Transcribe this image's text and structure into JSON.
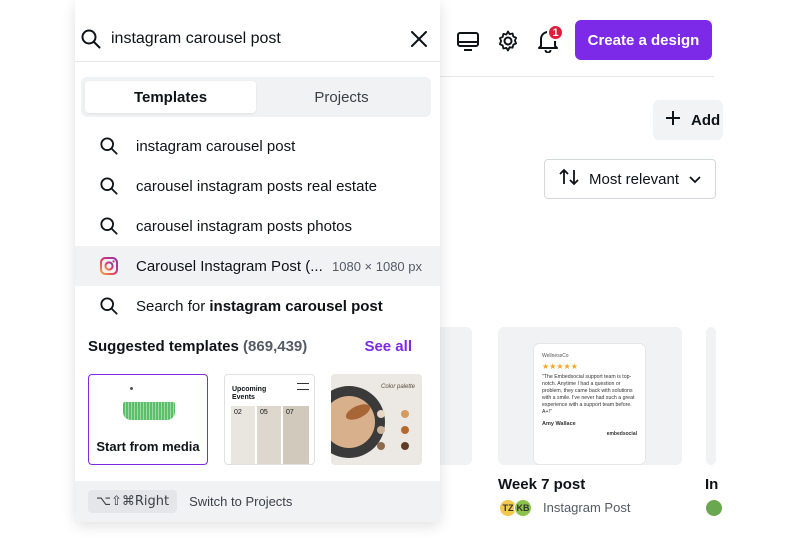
{
  "search": {
    "value": "instagram carousel post"
  },
  "tabs": [
    {
      "label": "Templates",
      "active": true
    },
    {
      "label": "Projects",
      "active": false
    }
  ],
  "suggestions": [
    {
      "text": "instagram carousel post",
      "icon": "search-icon"
    },
    {
      "text": "carousel instagram posts real estate",
      "icon": "search-icon"
    },
    {
      "text": "carousel instagram posts photos",
      "icon": "search-icon"
    }
  ],
  "highlighted_result": {
    "text": "Carousel Instagram Post (...",
    "dims": "1080 × 1080 px",
    "icon": "instagram-icon"
  },
  "search_for": {
    "prefix": "Search for ",
    "query": "instagram carousel post"
  },
  "suggested": {
    "title": "Suggested templates",
    "count": "(869,439)",
    "see_all": "See all",
    "start_label": "Start from media",
    "tpl2": {
      "title": "Upcoming",
      "subtitle": "Events",
      "dates": [
        "02",
        "05",
        "07"
      ]
    },
    "tpl3": {
      "title": "Color palette"
    }
  },
  "footer": {
    "shortcut": "⌥⇧⌘Right",
    "label": "Switch to Projects"
  },
  "topbar": {
    "notification_count": "1",
    "create_button": "Create a design"
  },
  "toolbar": {
    "add_label": "Add",
    "sort_label": "Most relevant"
  },
  "card": {
    "title": "Week 7 post",
    "subtitle": "Instagram Post",
    "avatars": [
      "TZ",
      "KB"
    ],
    "quote": "\"The Embedsocial support team is top-notch. Anytime I had a question or problem, they came back with solutions with a smile. I've never had such a great experience with a support team before. A+!\"",
    "author": "Amy Wallace",
    "stars": "★★★★★",
    "brand": "embedsocial",
    "header": "WellnessCo"
  },
  "edge_card": {
    "title": "In"
  },
  "colors": {
    "brand": "#7d2ae8",
    "badge": "#e01e3c",
    "panel_bg": "#ffffff",
    "muted_bg": "#f1f2f4"
  }
}
